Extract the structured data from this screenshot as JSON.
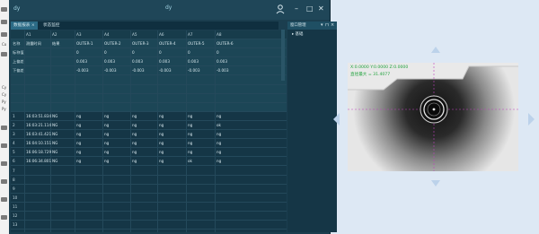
{
  "app": {
    "title_icon": "dy",
    "title_center": "dy",
    "window_controls": {
      "minimize": "–",
      "maximize": "□",
      "close": "✕"
    }
  },
  "tabs": [
    {
      "label": "数据报表",
      "close": "×"
    },
    {
      "label": "状态监控",
      "close": ""
    }
  ],
  "table": {
    "columns": [
      "",
      "A1",
      "A2",
      "A3",
      "A4",
      "A5",
      "A6",
      "A7",
      "A8"
    ],
    "meta_rows": [
      [
        "名称",
        "测量时间",
        "结果",
        "OUTER-1",
        "OUTER-2",
        "OUTER-3",
        "OUTER-4",
        "OUTER-5",
        "OUTER-6"
      ],
      [
        "标称值",
        "",
        "",
        "0",
        "0",
        "0",
        "0",
        "0",
        "0"
      ],
      [
        "上偏差",
        "",
        "",
        "0.003",
        "0.003",
        "0.003",
        "0.003",
        "0.003",
        "0.003"
      ],
      [
        "下偏差",
        "",
        "",
        "-0.003",
        "-0.003",
        "-0.003",
        "-0.003",
        "-0.003",
        "-0.003"
      ]
    ],
    "data_rows": [
      [
        "1",
        "16:03:51.834",
        "NG",
        "ng",
        "ng",
        "ng",
        "ng",
        "ng",
        "ng"
      ],
      [
        "2",
        "16:03:21.114",
        "NG",
        "ng",
        "ng",
        "ng",
        "ng",
        "ng",
        "ok"
      ],
      [
        "3",
        "16:03:41.421",
        "NG",
        "ng",
        "ng",
        "ng",
        "ng",
        "ng",
        "ng"
      ],
      [
        "4",
        "16:04:10.151",
        "NG",
        "ng",
        "ng",
        "ng",
        "ng",
        "ng",
        "ng"
      ],
      [
        "5",
        "16:06:18.729",
        "NG",
        "ng",
        "ng",
        "ng",
        "ng",
        "ng",
        "ng"
      ],
      [
        "6",
        "16:06:34.801",
        "NG",
        "ng",
        "ng",
        "ng",
        "ng",
        "ok",
        "ng"
      ],
      [
        "7",
        "",
        "",
        "",
        "",
        "",
        "",
        "",
        ""
      ],
      [
        "8",
        "",
        "",
        "",
        "",
        "",
        "",
        "",
        ""
      ],
      [
        "9",
        "",
        "",
        "",
        "",
        "",
        "",
        "",
        ""
      ],
      [
        "10",
        "",
        "",
        "",
        "",
        "",
        "",
        "",
        ""
      ],
      [
        "11",
        "",
        "",
        "",
        "",
        "",
        "",
        "",
        ""
      ],
      [
        "12",
        "",
        "",
        "",
        "",
        "",
        "",
        "",
        ""
      ],
      [
        "13",
        "",
        "",
        "",
        "",
        "",
        "",
        "",
        ""
      ]
    ]
  },
  "side_panel": {
    "title": "窗口管理",
    "controls": [
      "▾",
      "⊓",
      "×"
    ],
    "item": "▸ 基础"
  },
  "left_strip": {
    "labels": [
      "Co",
      "Cy",
      "Cy",
      "Py",
      "Py"
    ]
  },
  "camera": {
    "readout": "X:0.0000  Y:0.0000  Z:0.0000",
    "value": "直径最大 = 31.4077"
  },
  "colors": {
    "accent": "#2c6b86",
    "app_bg": "#1b3e4f",
    "readout": "#1fa23b"
  }
}
